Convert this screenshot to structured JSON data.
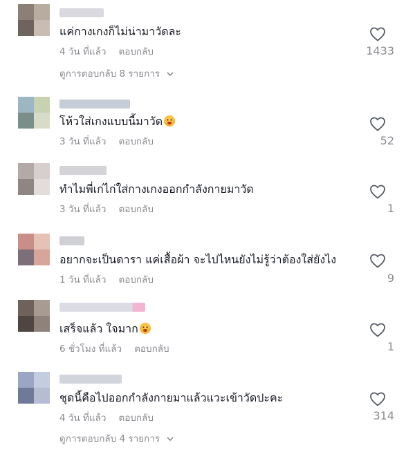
{
  "comments": [
    {
      "text": "แค่กางเกงก็ไม่น่ามาวัดละ",
      "time": "4 วัน ที่แล้ว",
      "reply": "ตอบกลับ",
      "likes": "1433",
      "view_replies": "ดูการตอบกลับ 8 รายการ",
      "avatar_colors": [
        "#8c8076",
        "#b8aba0",
        "#6e645d",
        "#c9bdb3"
      ],
      "username_color": "#d9d9df"
    },
    {
      "text": "โห้วใส่เกงแบบนี้มาวัด",
      "emoji": "flushed-face-emoji",
      "time": "3 วัน ที่แล้ว",
      "reply": "ตอบกลับ",
      "likes": "52",
      "avatar_colors": [
        "#9db6c4",
        "#c7d3b0",
        "#7a8f8a",
        "#d9dbc9"
      ],
      "username_color": "#c6ccd6"
    },
    {
      "text": "ทำไมพี่เก่ไก่ใส่กางเกงออกกำลังกายมาวัด",
      "time": "3 วัน ที่แล้ว",
      "reply": "ตอบกลับ",
      "likes": "1",
      "avatar_colors": [
        "#b3aaa8",
        "#d6cfcd",
        "#8f8684",
        "#e2dcda"
      ],
      "username_color": "#d4d4d8"
    },
    {
      "text": "อยากจะเป็นดารา แค่เสื้อผ้า จะไปไหนยังไม่รู้ว่าต้องใส่ยังไง",
      "time": "1 วัน ที่แล้ว",
      "reply": "ตอบกลับ",
      "likes": "9",
      "avatar_colors": [
        "#c98f86",
        "#e6c1b6",
        "#7d6f7a",
        "#d8a59b"
      ],
      "username_color": "#cfd0d6"
    },
    {
      "text": "เสร็จแล้ว ใจมาก",
      "emoji": "flushed-face-emoji",
      "time": "6 ชั่วโมง ที่แล้ว",
      "reply": "ตอบกลับ",
      "likes": "1",
      "avatar_colors": [
        "#6e625b",
        "#a89b92",
        "#4f4641",
        "#8f827a"
      ],
      "username_color": "#dcdce4"
    },
    {
      "text": "ชุดนี้คือไปออกกำลังกายมาแล้วแวะเข้าวัดปะคะ",
      "time": "4 วัน ที่แล้ว",
      "reply": "ตอบกลับ",
      "likes": "314",
      "view_replies": "ดูการตอบกลับ 4 รายการ",
      "avatar_colors": [
        "#9aa6c4",
        "#c4cce0",
        "#6f7a99",
        "#b6bdd2"
      ],
      "username_color": "#d3d5de"
    }
  ],
  "icons": {
    "like": "heart-outline-icon",
    "expand": "chevron-down-icon"
  },
  "colors": {
    "text": "#161823",
    "muted": "#8a8b91",
    "icon": "#555a63"
  }
}
